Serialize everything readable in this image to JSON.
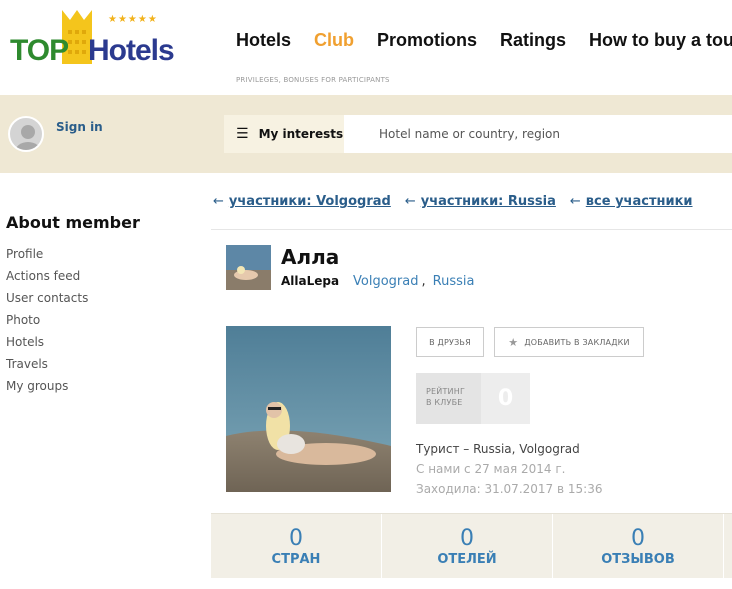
{
  "header": {
    "logo": {
      "top": "TOP",
      "hotels": "Hotels",
      "stars": "★★★★★"
    },
    "nav": [
      "Hotels",
      "Club",
      "Promotions",
      "Ratings",
      "How to buy a tour"
    ],
    "active_nav": "Club",
    "nav_subtitle": "PRIVILEGES, BONUSES FOR PARTICIPANTS"
  },
  "userbar": {
    "signin_label": "Sign in",
    "interests_label": "My interests",
    "search_placeholder": "Hotel name or country, region"
  },
  "sidebar": {
    "title": "About member",
    "items": [
      "Profile",
      "Actions feed",
      "User contacts",
      "Photo",
      "Hotels",
      "Travels",
      "My groups"
    ]
  },
  "breadcrumbs": [
    {
      "arrow": "←",
      "text": "участники: Volgograd"
    },
    {
      "arrow": "←",
      "text": "участники: Russia"
    },
    {
      "arrow": "←",
      "text": "все участники"
    }
  ],
  "profile": {
    "name": "Алла",
    "login": "AllaLepa",
    "city": "Volgograd",
    "country": "Russia",
    "add_friend_label": "В ДРУЗЬЯ",
    "bookmark_label": "ДОБАВИТЬ В ЗАКЛАДКИ",
    "rating_label_line1": "РЕЙТИНГ",
    "rating_label_line2": "В КЛУБЕ",
    "rating_value": "0",
    "status": "Турист – Russia, Volgograd",
    "joined": "С нами с 27 мая 2014 г.",
    "last_visit": "Заходила: 31.07.2017 в 15:36"
  },
  "stats": [
    {
      "value": "0",
      "label": "СТРАН"
    },
    {
      "value": "0",
      "label": "ОТЕЛЕЙ"
    },
    {
      "value": "0",
      "label": "ОТЗЫВОВ"
    }
  ],
  "colors": {
    "accent": "#f0a030",
    "link": "#2a5d8a",
    "stat_blue": "#3a7fb5",
    "band": "#efe8d4"
  }
}
